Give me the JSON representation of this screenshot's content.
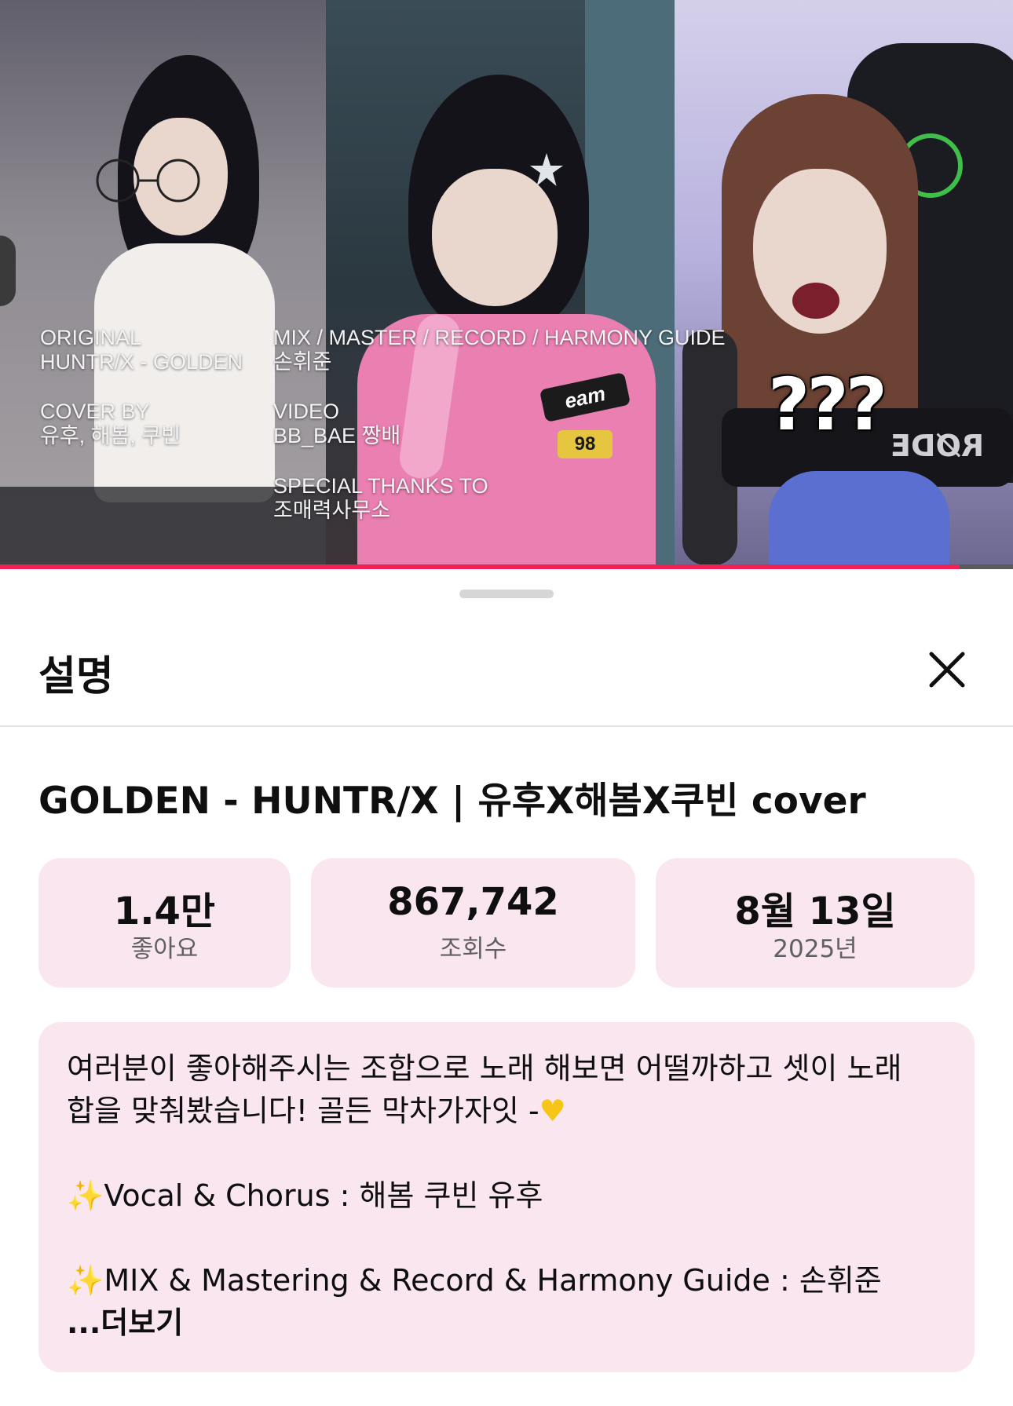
{
  "video": {
    "credits": {
      "original_label": "ORIGINAL",
      "original_value": "HUNTR/X - GOLDEN",
      "cover_label": "COVER BY",
      "cover_value": "유후, 해봄, 쿠빈",
      "mix_label": "MIX / MASTER / RECORD / HARMONY GUIDE",
      "mix_value": "손휘준",
      "video_label": "VIDEO",
      "video_value": "BB_BAE 짱배",
      "thanks_label": "SPECIAL THANKS TO",
      "thanks_value": "조매력사무소"
    },
    "overlay_caption": "???",
    "mic_brand": "RØDE",
    "jacket_text": "eam",
    "jacket_number": "98",
    "progress_fraction": 0.947,
    "colors": {
      "progress": "#ee2256",
      "track": "#5a5a5a"
    }
  },
  "sheet": {
    "title": "설명",
    "close_icon": "close-icon",
    "video_title": "GOLDEN - HUNTR/X | 유후X해봄X쿠빈 cover",
    "stats": [
      {
        "value": "1.4만",
        "label": "좋아요"
      },
      {
        "value": "867,742",
        "label": "조회수"
      },
      {
        "value": "8월 13일",
        "label": "2025년"
      }
    ],
    "description": {
      "line1": "여러분이 좋아해주시는 조합으로 노래 해보면 어떨까하고 셋이 노래",
      "line2": "합을 맞춰봤습니다! 골든 막차가자잇 -",
      "heart_icon": "yellow-heart-icon",
      "sparkle_icon": "sparkles-icon",
      "line3": "Vocal & Chorus : 해봄 쿠빈 유후",
      "line4": "MIX & Mastering & Record & Harmony Guide : 손휘준",
      "more_label": "...더보기"
    },
    "colors": {
      "stat_bg": "#f9e6ef",
      "text": "#0f0f0f",
      "subtext": "#606060"
    }
  }
}
